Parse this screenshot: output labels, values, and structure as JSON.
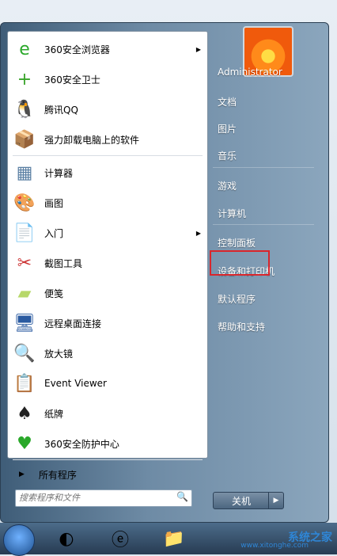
{
  "left_items": [
    {
      "label": "360安全浏览器",
      "icon": "360-browser-icon",
      "glyph": "e",
      "color": "#2aa82a",
      "arrow": true
    },
    {
      "label": "360安全卫士",
      "icon": "360-guard-icon",
      "glyph": "+",
      "color": "#3aa42a",
      "arrow": false
    },
    {
      "label": "腾讯QQ",
      "icon": "qq-penguin-icon",
      "glyph": "🐧",
      "color": "#000",
      "arrow": false
    },
    {
      "label": "强力卸载电脑上的软件",
      "icon": "uninstall-box-icon",
      "glyph": "📦",
      "color": "#c58a3a",
      "arrow": false
    },
    {
      "label": "计算器",
      "icon": "calculator-icon",
      "glyph": "▦",
      "color": "#5a7fa3",
      "arrow": false
    },
    {
      "label": "画图",
      "icon": "paint-palette-icon",
      "glyph": "🎨",
      "color": "#d9743a",
      "arrow": false
    },
    {
      "label": "入门",
      "icon": "getting-started-icon",
      "glyph": "📄",
      "color": "#3a6bb5",
      "arrow": true
    },
    {
      "label": "截图工具",
      "icon": "snipping-tool-icon",
      "glyph": "✂",
      "color": "#c33",
      "arrow": false
    },
    {
      "label": "便笺",
      "icon": "sticky-notes-icon",
      "glyph": "▰",
      "color": "#b7d86a",
      "arrow": false
    },
    {
      "label": "远程桌面连接",
      "icon": "remote-desktop-icon",
      "glyph": "🖥",
      "color": "#2a5aa0",
      "arrow": false
    },
    {
      "label": "放大镜",
      "icon": "magnifier-icon",
      "glyph": "🔍",
      "color": "#2a5aa0",
      "arrow": false
    },
    {
      "label": "Event Viewer",
      "icon": "event-viewer-icon",
      "glyph": "📋",
      "color": "#3a6bb5",
      "arrow": false
    },
    {
      "label": "纸牌",
      "icon": "solitaire-icon",
      "glyph": "♠",
      "color": "#222",
      "arrow": false
    },
    {
      "label": "360安全防护中心",
      "icon": "360-shield-icon",
      "glyph": "♥",
      "color": "#2aa82a",
      "arrow": false
    }
  ],
  "all_programs": "所有程序",
  "search": {
    "placeholder": "搜索程序和文件"
  },
  "right_items": [
    "Administrator",
    "文档",
    "图片",
    "音乐",
    "游戏",
    "计算机",
    "控制面板",
    "设备和打印机",
    "默认程序",
    "帮助和支持"
  ],
  "shutdown_label": "关机",
  "watermark": {
    "text": "系统之家",
    "url": "www.xitonghe.com"
  }
}
